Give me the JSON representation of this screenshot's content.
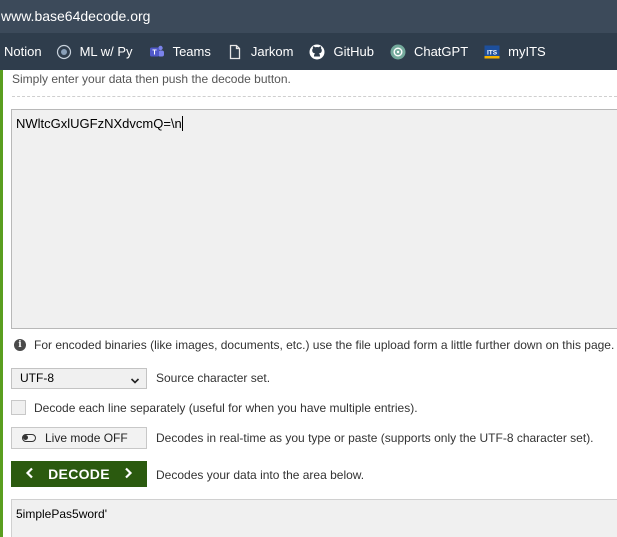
{
  "browser": {
    "url": "www.base64decode.org",
    "bookmarks": [
      {
        "label": "Notion",
        "icon": "notion-icon"
      },
      {
        "label": "ML w/ Py",
        "icon": "globe-icon"
      },
      {
        "label": "Teams",
        "icon": "teams-icon"
      },
      {
        "label": "Jarkom",
        "icon": "document-icon"
      },
      {
        "label": "GitHub",
        "icon": "github-icon"
      },
      {
        "label": "ChatGPT",
        "icon": "chatgpt-icon"
      },
      {
        "label": "myITS",
        "icon": "myits-icon"
      }
    ]
  },
  "page": {
    "intro": "Simply enter your data then push the decode button.",
    "input_value": "NWltcGxlUGFzNXdvcmQ=\\n",
    "info_text": "For encoded binaries (like images, documents, etc.) use the file upload form a little further down on this page.",
    "charset": {
      "selected": "UTF-8",
      "label": "Source character set."
    },
    "line_checkbox": {
      "label": "Decode each line separately (useful for when you have multiple entries).",
      "checked": false
    },
    "live_mode": {
      "button": "Live mode OFF",
      "label": "Decodes in real-time as you type or paste (supports only the UTF-8 character set)."
    },
    "decode": {
      "button": "DECODE",
      "label": "Decodes your data into the area below."
    },
    "output_value": "5implePas5word'"
  },
  "colors": {
    "accent_green": "#2b5a0f",
    "stripe_green": "#5a9e1f",
    "toolbar": "#3c4a5a"
  }
}
